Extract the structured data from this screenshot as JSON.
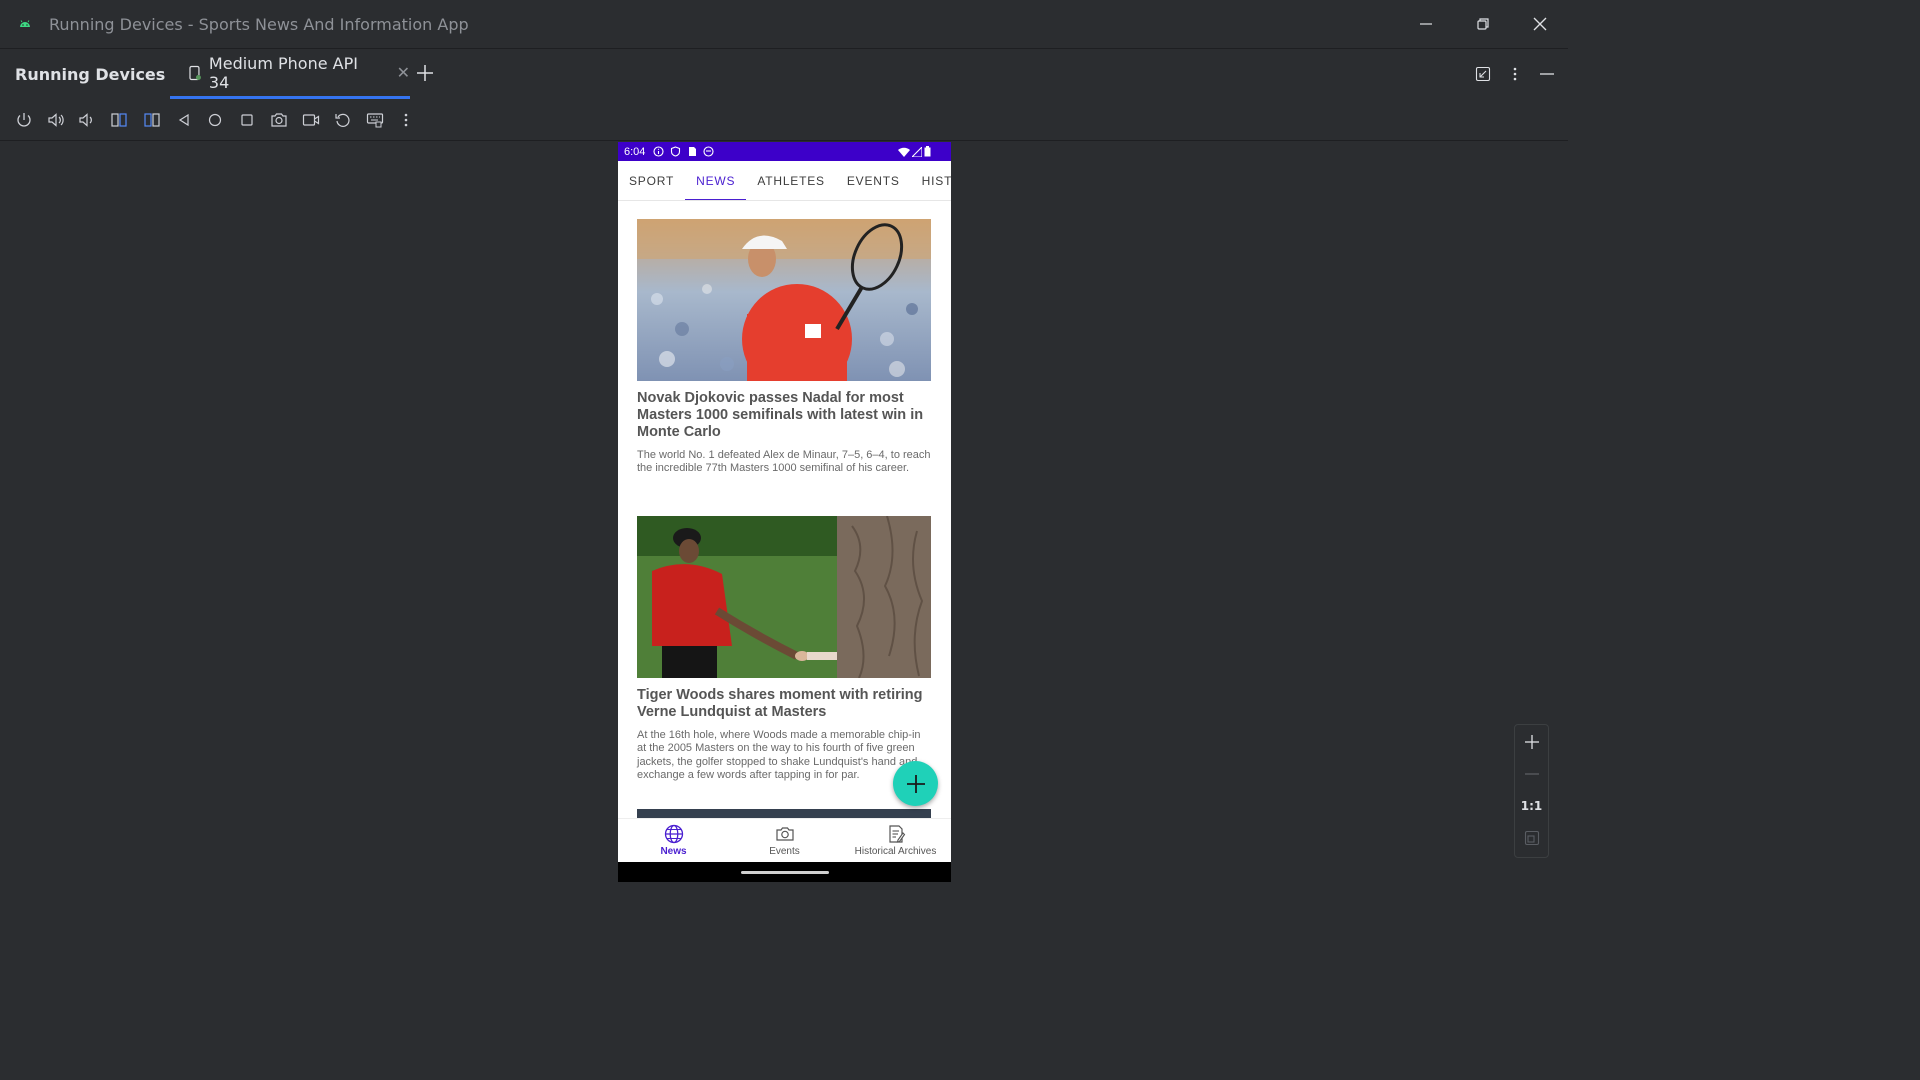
{
  "window": {
    "title": "Running Devices - Sports News And Information App"
  },
  "toolwindow": {
    "title": "Running Devices",
    "device_tab": "Medium Phone API 34"
  },
  "toolbar": {
    "icons": [
      "power-icon",
      "volume-up-icon",
      "volume-down-icon",
      "rotate-left-icon",
      "rotate-right-icon",
      "back-icon",
      "home-icon",
      "overview-icon",
      "screenshot-icon",
      "record-icon",
      "reset-icon",
      "keyboard-icon",
      "more-icon"
    ]
  },
  "phone": {
    "status": {
      "time": "6:04"
    },
    "tabs": [
      "SPORT",
      "NEWS",
      "ATHLETES",
      "EVENTS",
      "HISTORIC"
    ],
    "active_tab": "NEWS",
    "articles": [
      {
        "title": "Novak Djokovic passes Nadal for most Masters 1000 semifinals with latest win in Monte Carlo",
        "summary": "The world No. 1 defeated Alex de Minaur, 7–5, 6–4, to reach the incredible 77th Masters 1000 semifinal of his career."
      },
      {
        "title": "Tiger Woods shares moment with retiring Verne Lundquist at Masters",
        "summary": "At the 16th hole, where Woods made a memorable chip-in at the 2005 Masters on the way to his fourth of five green jackets, the golfer stopped to shake Lundquist's hand and exchange a few words after tapping in for par."
      }
    ],
    "bottom_nav": [
      {
        "label": "News",
        "icon": "globe-icon"
      },
      {
        "label": "Events",
        "icon": "camera-icon"
      },
      {
        "label": "Historical Archives",
        "icon": "edit-note-icon"
      }
    ],
    "colors": {
      "status_bar": "#3d00c9",
      "accent": "#4a1fd0",
      "fab": "#1fd1b8"
    }
  },
  "zoom": {
    "actual_size_label": "1:1"
  }
}
